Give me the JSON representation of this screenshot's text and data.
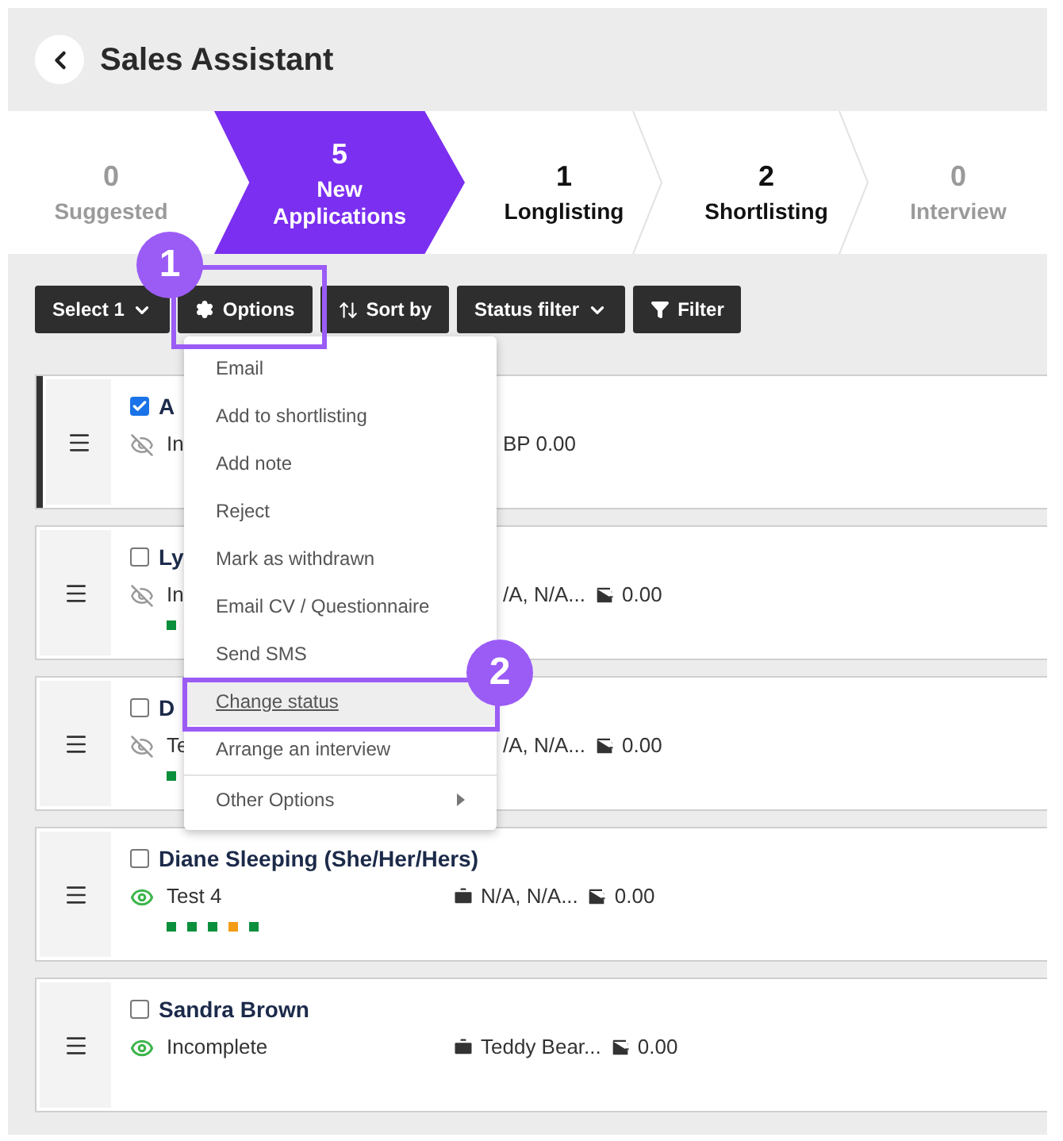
{
  "header": {
    "title": "Sales Assistant"
  },
  "stages": [
    {
      "count": "0",
      "label": "Suggested",
      "selected": false,
      "disabled": true
    },
    {
      "count": "5",
      "label": "New Applications",
      "selected": true,
      "disabled": false
    },
    {
      "count": "1",
      "label": "Longlisting",
      "selected": false,
      "disabled": false
    },
    {
      "count": "2",
      "label": "Shortlisting",
      "selected": false,
      "disabled": false
    },
    {
      "count": "0",
      "label": "Interview",
      "selected": false,
      "disabled": true
    }
  ],
  "toolbar": [
    {
      "label": "Select 1",
      "kind": "dropdown"
    },
    {
      "label": "Options",
      "kind": "gear"
    },
    {
      "label": "Sort by",
      "kind": "sort"
    },
    {
      "label": "Status filter",
      "kind": "dropdown"
    },
    {
      "label": "Filter",
      "kind": "funnel"
    }
  ],
  "menu": [
    {
      "label": "Email",
      "selected": false,
      "kind": "item"
    },
    {
      "label": "Add to shortlisting",
      "selected": false,
      "kind": "item"
    },
    {
      "label": "Add note",
      "selected": false,
      "kind": "item"
    },
    {
      "label": "Reject",
      "selected": false,
      "kind": "item"
    },
    {
      "label": "Mark as withdrawn",
      "selected": false,
      "kind": "item"
    },
    {
      "label": "Email CV / Questionnaire",
      "selected": false,
      "kind": "item"
    },
    {
      "label": "Send SMS",
      "selected": false,
      "kind": "item"
    },
    {
      "label": "Change status",
      "selected": true,
      "kind": "item"
    },
    {
      "label": "Arrange an interview",
      "selected": false,
      "kind": "item"
    },
    {
      "label": "Other Options",
      "selected": false,
      "kind": "submenu"
    }
  ],
  "callouts": [
    {
      "number": "1"
    },
    {
      "number": "2"
    }
  ],
  "candidates": [
    {
      "name": "A",
      "checked": true,
      "selected": true,
      "hidden": true,
      "status": "In",
      "job": {
        "text": "BP 0.00",
        "covered": true
      }
    },
    {
      "name": "Ly",
      "checked": false,
      "selected": false,
      "hidden": true,
      "status": "In",
      "job": {
        "text": "/A, N/A...",
        "covered": true
      },
      "salary": "0.00",
      "dots": [
        {
          "color": "#0a8f3c"
        }
      ]
    },
    {
      "name": "D",
      "checked": false,
      "selected": false,
      "hidden": true,
      "status": "Te",
      "job": {
        "text": "/A, N/A...",
        "covered": true
      },
      "salary": "0.00",
      "dots": [
        {
          "color": "#0a8f3c"
        }
      ]
    },
    {
      "name": "Diane Sleeping (She/Her/Hers)",
      "checked": false,
      "selected": false,
      "hidden": false,
      "status": "Test 4",
      "job": {
        "text": "N/A, N/A...",
        "covered": false
      },
      "salary": "0.00",
      "dots": [
        {
          "color": "#0a8f3c"
        },
        {
          "color": "#0a8f3c"
        },
        {
          "color": "#0a8f3c"
        },
        {
          "color": "#f39c12"
        },
        {
          "color": "#0a8f3c"
        }
      ]
    },
    {
      "name": "Sandra Brown",
      "checked": false,
      "selected": false,
      "hidden": false,
      "status": "Incomplete",
      "job": {
        "text": "Teddy Bear...",
        "covered": false
      },
      "salary": "0.00"
    }
  ]
}
